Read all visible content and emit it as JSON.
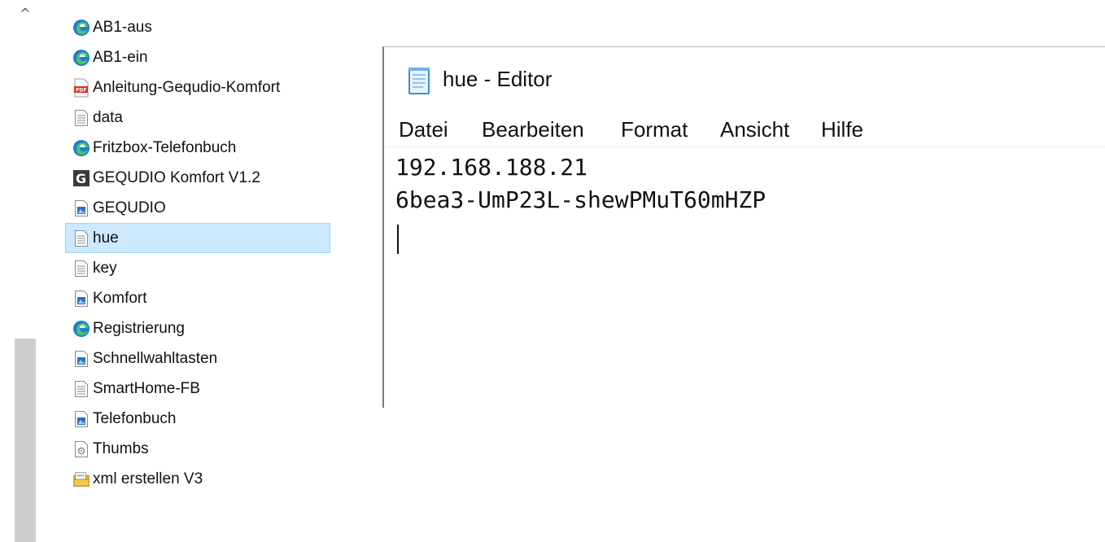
{
  "files": [
    {
      "name": "AB1-aus",
      "icon": "edge-icon"
    },
    {
      "name": "AB1-ein",
      "icon": "edge-icon"
    },
    {
      "name": "Anleitung-Gequdio-Komfort",
      "icon": "pdf-icon"
    },
    {
      "name": "data",
      "icon": "text-file-icon"
    },
    {
      "name": "Fritzbox-Telefonbuch",
      "icon": "edge-icon"
    },
    {
      "name": "GEQUDIO Komfort V1.2",
      "icon": "gequdio-app-icon"
    },
    {
      "name": "GEQUDIO",
      "icon": "image-file-icon"
    },
    {
      "name": "hue",
      "icon": "text-file-icon",
      "selected": true
    },
    {
      "name": "key",
      "icon": "text-file-icon"
    },
    {
      "name": "Komfort",
      "icon": "image-file-icon"
    },
    {
      "name": "Registrierung",
      "icon": "edge-icon"
    },
    {
      "name": "Schnellwahltasten",
      "icon": "image-file-icon"
    },
    {
      "name": "SmartHome-FB",
      "icon": "text-file-icon"
    },
    {
      "name": "Telefonbuch",
      "icon": "image-file-icon"
    },
    {
      "name": "Thumbs",
      "icon": "system-file-icon"
    },
    {
      "name": "xml erstellen V3",
      "icon": "batch-file-icon"
    }
  ],
  "notepad": {
    "title": "hue - Editor",
    "menu": [
      "Datei",
      "Bearbeiten",
      "Format",
      "Ansicht",
      "Hilfe"
    ],
    "lines": [
      "192.168.188.21",
      "6bea3-UmP23L-shewPMuT60mHZP"
    ]
  },
  "scrollbar": {
    "up_arrow": "^"
  },
  "colors": {
    "selection_bg": "#cce8ff",
    "selection_border": "#99d1ff",
    "scroll_thumb": "#cdcdcd"
  }
}
